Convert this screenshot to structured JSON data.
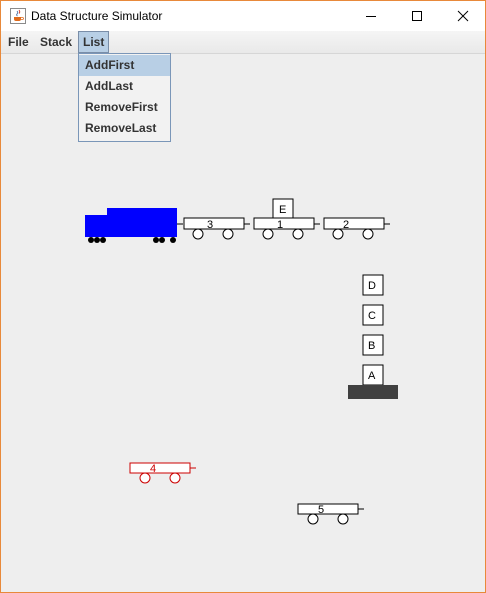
{
  "window": {
    "title": "Data Structure Simulator"
  },
  "menubar": {
    "items": [
      "File",
      "Stack",
      "List"
    ],
    "open_menu": "List"
  },
  "dropdown": {
    "items": [
      "AddFirst",
      "AddLast",
      "RemoveFirst",
      "RemoveLast"
    ],
    "selected": "AddFirst"
  },
  "train": {
    "cars": [
      "3",
      "1",
      "2"
    ],
    "cargo": "E"
  },
  "stack": {
    "items": [
      "D",
      "C",
      "B",
      "A"
    ]
  },
  "loose_cars": [
    {
      "label": "4",
      "highlighted": true
    },
    {
      "label": "5",
      "highlighted": false
    }
  ],
  "colors": {
    "engine": "#0000ff",
    "highlight": "#cc0000",
    "stack_base": "#404040",
    "menu_selection": "#b8cfe5"
  },
  "icons": {
    "app": "java-cup-icon",
    "minimize": "minimize-icon",
    "maximize": "maximize-icon",
    "close": "close-icon"
  }
}
